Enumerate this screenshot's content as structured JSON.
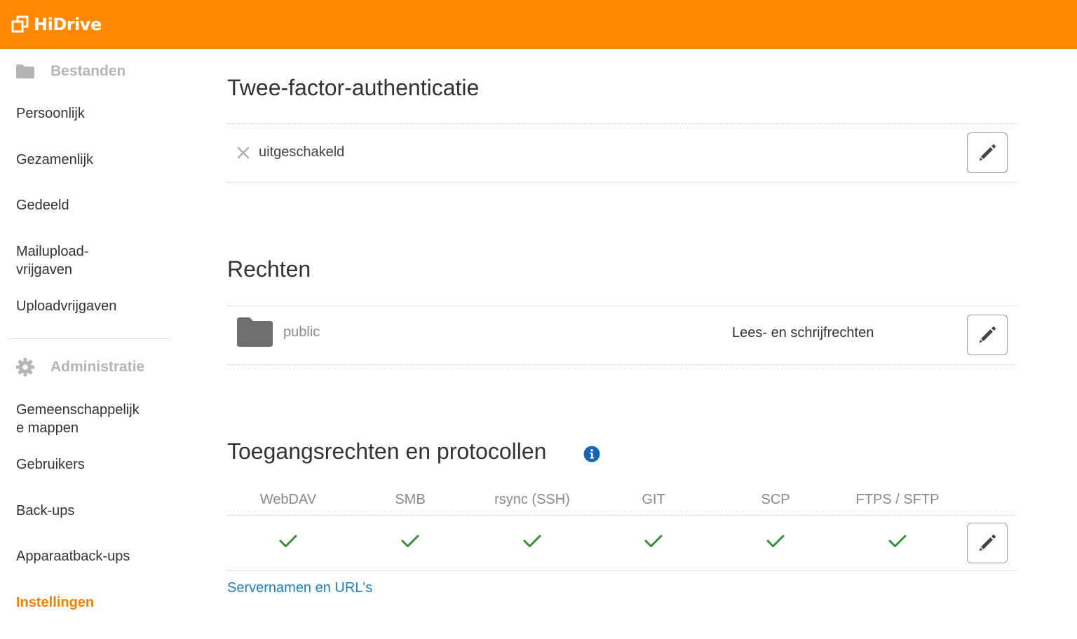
{
  "app": {
    "logo_text": "HiDrive",
    "accent_color": "#ff8800"
  },
  "sidebar": {
    "files_header": {
      "label": "Bestanden",
      "icon": "folder-icon"
    },
    "files_items": [
      {
        "label": "Persoonlijk"
      },
      {
        "label": "Gezamenlijk"
      },
      {
        "label": "Gedeeld"
      },
      {
        "label": "Mailupload-\nvrijgaven"
      },
      {
        "label": "Uploadvrijgaven"
      }
    ],
    "admin_header": {
      "label": "Administratie",
      "icon": "gear-icon"
    },
    "admin_items": [
      {
        "label": "Gemeenschappelijk\ne mappen"
      },
      {
        "label": "Gebruikers"
      },
      {
        "label": "Back-ups"
      },
      {
        "label": "Apparaatback-ups"
      },
      {
        "label": "Instellingen",
        "active": true
      }
    ]
  },
  "two_factor": {
    "title": "Twee-factor-authenticatie",
    "status": "uitgeschakeld",
    "status_icon": "cross-icon",
    "edit_icon": "pencil-icon"
  },
  "rights": {
    "title": "Rechten",
    "folder_name": "public",
    "folder_icon": "folder-icon",
    "permission": "Lees- en schrijfrechten",
    "edit_icon": "pencil-icon"
  },
  "access": {
    "title": "Toegangsrechten en protocollen",
    "info_icon": "info-icon",
    "protocols": [
      {
        "name": "WebDAV",
        "enabled": true
      },
      {
        "name": "SMB",
        "enabled": true
      },
      {
        "name": "rsync (SSH)",
        "enabled": true
      },
      {
        "name": "GIT",
        "enabled": true
      },
      {
        "name": "SCP",
        "enabled": true
      },
      {
        "name": "FTPS / SFTP",
        "enabled": true
      }
    ],
    "check_color": "#3c8a3c",
    "link": "Servernamen en URL's"
  }
}
